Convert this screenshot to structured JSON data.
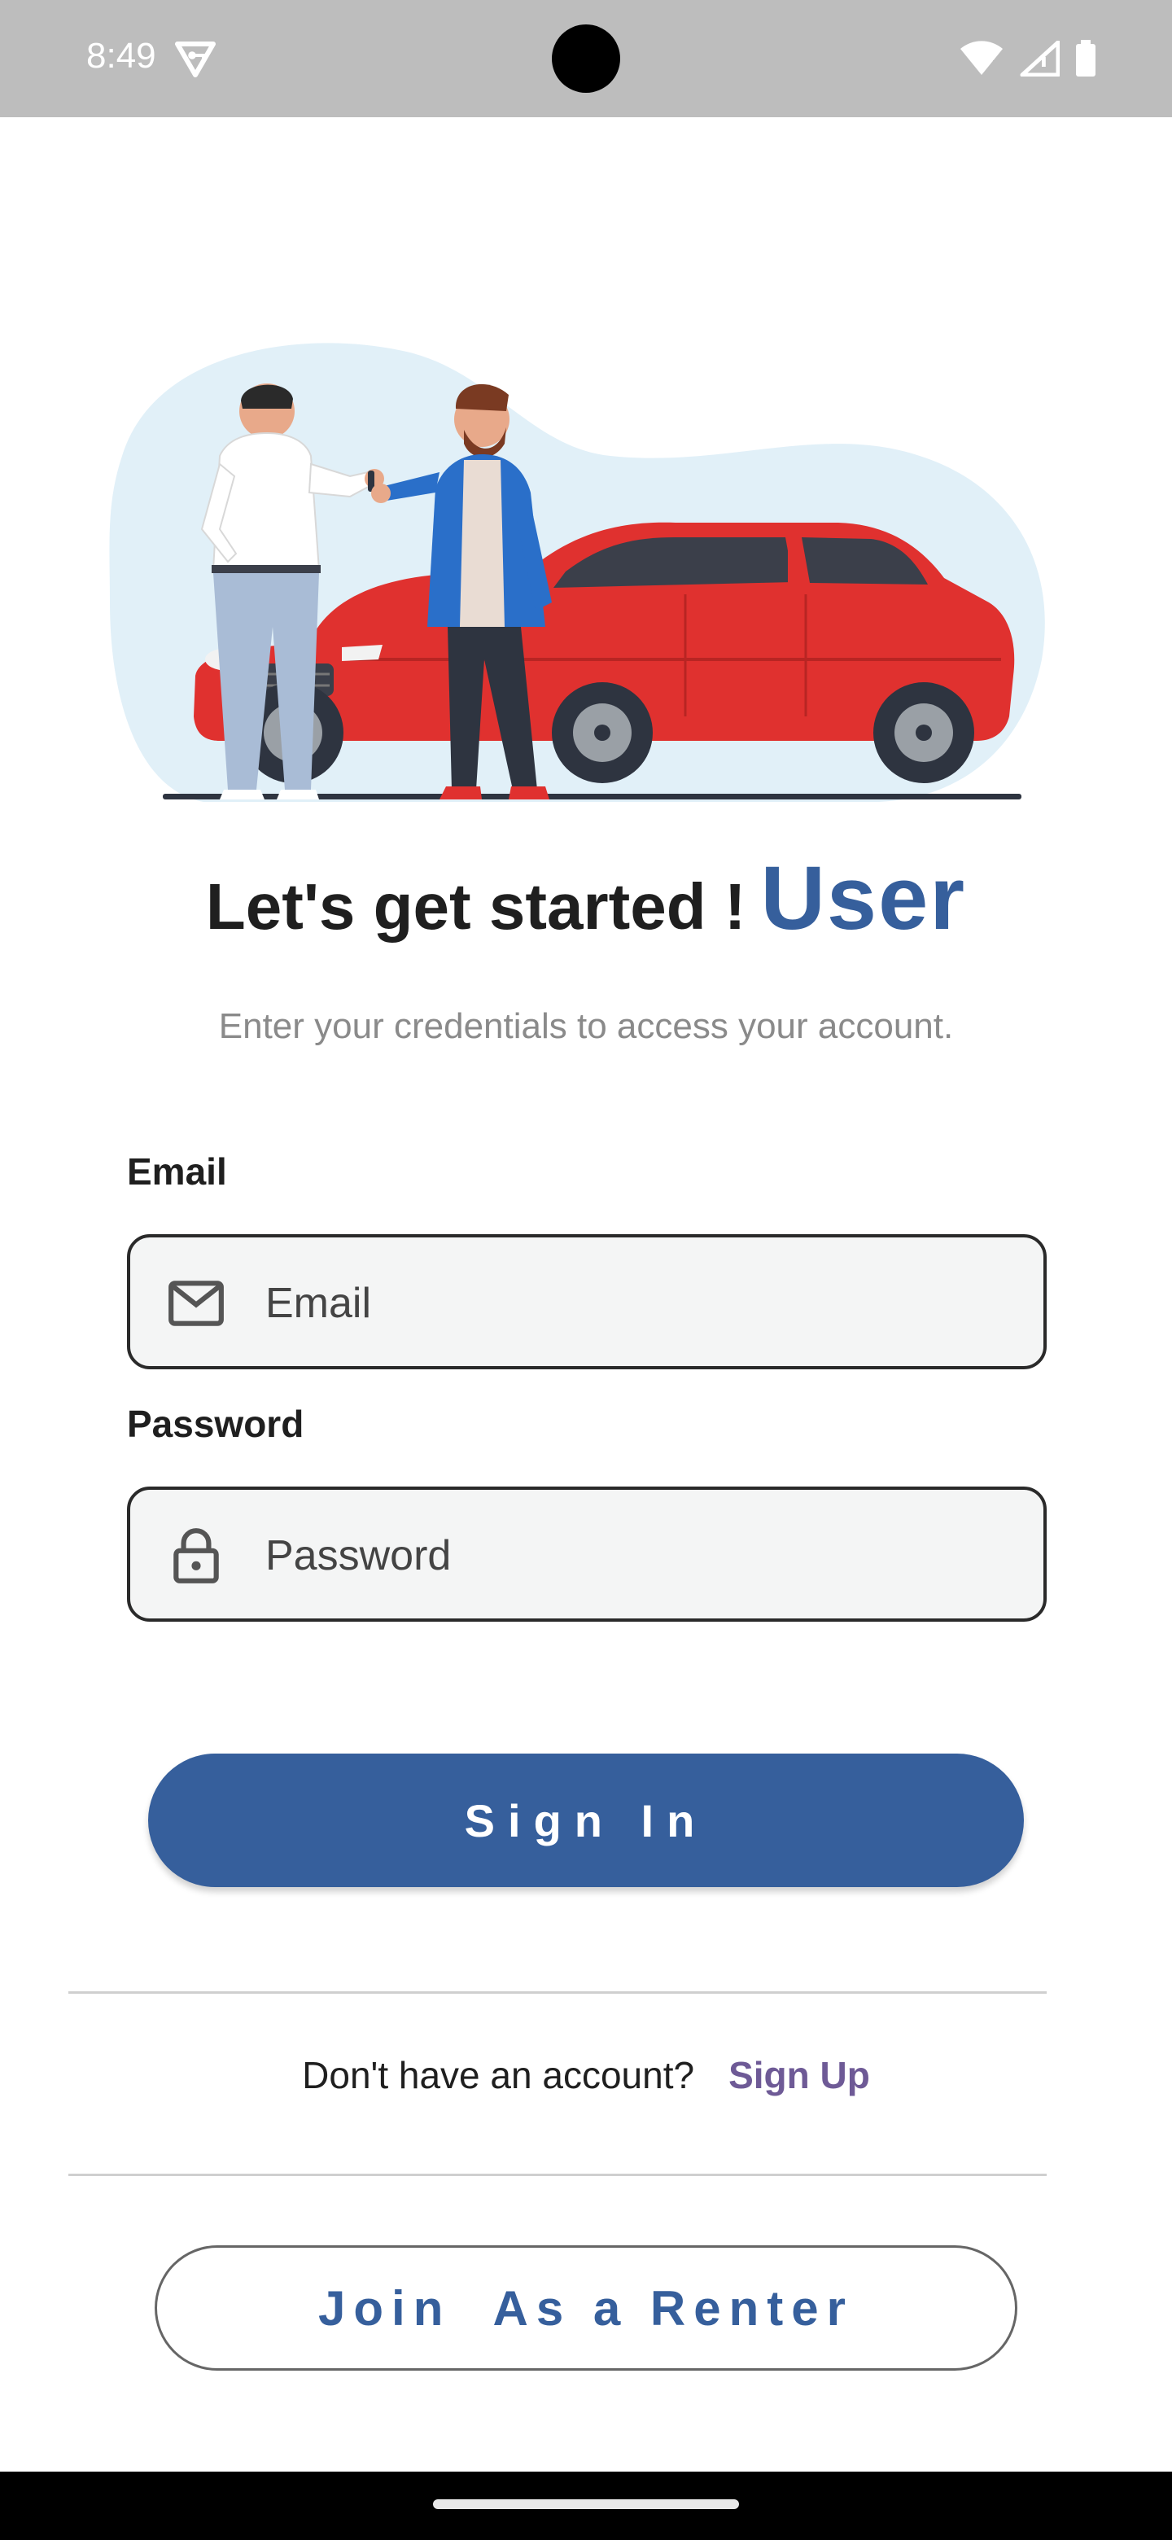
{
  "status_bar": {
    "time": "8:49",
    "icons": [
      "vpn-key-icon",
      "wifi-icon",
      "signal-icon",
      "battery-icon"
    ]
  },
  "illustration": {
    "name": "car-key-handover-illustration",
    "colors": {
      "blob": "#e1f0f8",
      "car": "#e0312f",
      "jacket": "#2a6fc9"
    }
  },
  "heading": {
    "main": "Let's get started !",
    "highlight": "User"
  },
  "subtitle": "Enter your credentials to access your account.",
  "form": {
    "email": {
      "label": "Email",
      "placeholder": "Email",
      "value": "",
      "icon": "mail-icon"
    },
    "password": {
      "label": "Password",
      "placeholder": "Password",
      "value": "",
      "icon": "lock-icon"
    }
  },
  "signin_button": "Sign In",
  "signup": {
    "prompt": "Don't have an account?",
    "link": "Sign Up"
  },
  "renter_button": "Join  As a Renter",
  "colors": {
    "primary": "#365f9c",
    "link": "#6e5a96",
    "field_bg": "#f4f5f5"
  }
}
